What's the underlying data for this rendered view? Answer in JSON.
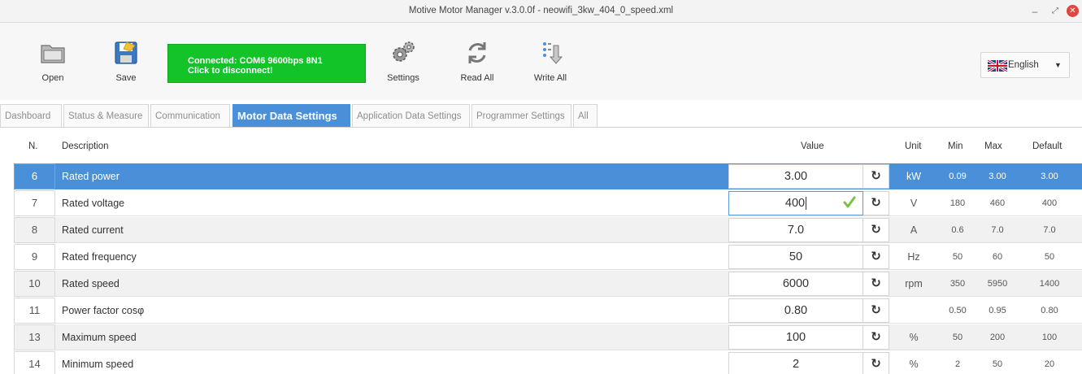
{
  "window": {
    "title": "Motive Motor Manager v.3.0.0f - neowifi_3kw_404_0_speed.xml",
    "minimize": "–",
    "maximize": "⤢",
    "close": "✕"
  },
  "toolbar": {
    "open_label": "Open",
    "save_label": "Save",
    "connection_line1": "Connected: COM6 9600bps 8N1",
    "connection_line2": "Click to disconnect!",
    "settings_label": "Settings",
    "read_all_label": "Read All",
    "write_all_label": "Write All",
    "language": "English",
    "language_caret": "▼",
    "connection_color": "#12c427"
  },
  "tabs": [
    {
      "label": "Dashboard"
    },
    {
      "label": "Status & Measure"
    },
    {
      "label": "Communication"
    },
    {
      "label": "Motor Data Settings"
    },
    {
      "label": "Application Data Settings"
    },
    {
      "label": "Programmer Settings"
    },
    {
      "label": "All"
    }
  ],
  "active_tab": "Motor Data Settings",
  "table": {
    "headers": {
      "num": "N.",
      "description": "Description",
      "value": "Value",
      "unit": "Unit",
      "min": "Min",
      "max": "Max",
      "default": "Default"
    },
    "reset_glyph": "↻",
    "rows": [
      {
        "num": "6",
        "description": "Rated power",
        "value": "3.00",
        "unit": "kW",
        "min": "0.09",
        "max": "3.00",
        "default": "3.00"
      },
      {
        "num": "7",
        "description": "Rated voltage",
        "value": "400",
        "unit": "V",
        "min": "180",
        "max": "460",
        "default": "400"
      },
      {
        "num": "8",
        "description": "Rated current",
        "value": "7.0",
        "unit": "A",
        "min": "0.6",
        "max": "7.0",
        "default": "7.0"
      },
      {
        "num": "9",
        "description": "Rated frequency",
        "value": "50",
        "unit": "Hz",
        "min": "50",
        "max": "60",
        "default": "50"
      },
      {
        "num": "10",
        "description": "Rated speed",
        "value": "6000",
        "unit": "rpm",
        "min": "350",
        "max": "5950",
        "default": "1400"
      },
      {
        "num": "11",
        "description": "Power factor cosφ",
        "value": "0.80",
        "unit": "",
        "min": "0.50",
        "max": "0.95",
        "default": "0.80"
      },
      {
        "num": "13",
        "description": "Maximum speed",
        "value": "100",
        "unit": "%",
        "min": "50",
        "max": "200",
        "default": "100"
      },
      {
        "num": "14",
        "description": "Minimum speed",
        "value": "2",
        "unit": "%",
        "min": "2",
        "max": "50",
        "default": "20"
      }
    ]
  },
  "colors": {
    "selection": "#4a90d9",
    "accent_tab": "#4a90d9",
    "valid_check": "#7cc242"
  }
}
